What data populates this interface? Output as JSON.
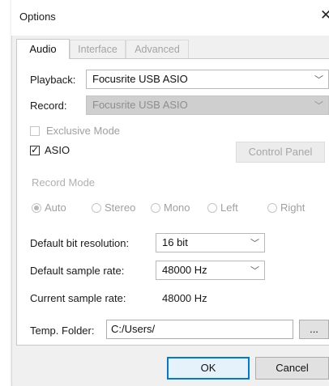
{
  "dialog": {
    "title": "Options",
    "close_glyph": "✕"
  },
  "tabs": [
    {
      "label": "Audio",
      "active": true
    },
    {
      "label": "Interface",
      "active": false
    },
    {
      "label": "Advanced",
      "active": false
    }
  ],
  "audio": {
    "playback_label": "Playback:",
    "playback_value": "Focusrite USB ASIO",
    "record_label": "Record:",
    "record_value": "Focusrite USB ASIO",
    "exclusive_mode_label": "Exclusive Mode",
    "exclusive_mode_checked": false,
    "asio_label": "ASIO",
    "asio_checked": true,
    "control_panel_label": "Control Panel",
    "record_mode": {
      "label": "Record Mode",
      "options": [
        "Auto",
        "Stereo",
        "Mono",
        "Left",
        "Right"
      ],
      "selected": "Auto"
    },
    "bit_resolution_label": "Default bit resolution:",
    "bit_resolution_value": "16 bit",
    "sample_rate_label": "Default sample rate:",
    "sample_rate_value": "48000 Hz",
    "current_rate_label": "Current sample rate:",
    "current_rate_value": "48000 Hz",
    "temp_folder_label": "Temp. Folder:",
    "temp_folder_value": "C:/Users/",
    "browse_label": "..."
  },
  "buttons": {
    "ok": "OK",
    "cancel": "Cancel"
  },
  "icons": {
    "chevron": "chevron-down-icon",
    "check": "checkmark-icon",
    "close": "close-icon"
  },
  "colors": {
    "default_button_border": "#0078d7",
    "disabled_fill": "#cfcfcf",
    "dialog_bg": "#f0f0f0"
  }
}
